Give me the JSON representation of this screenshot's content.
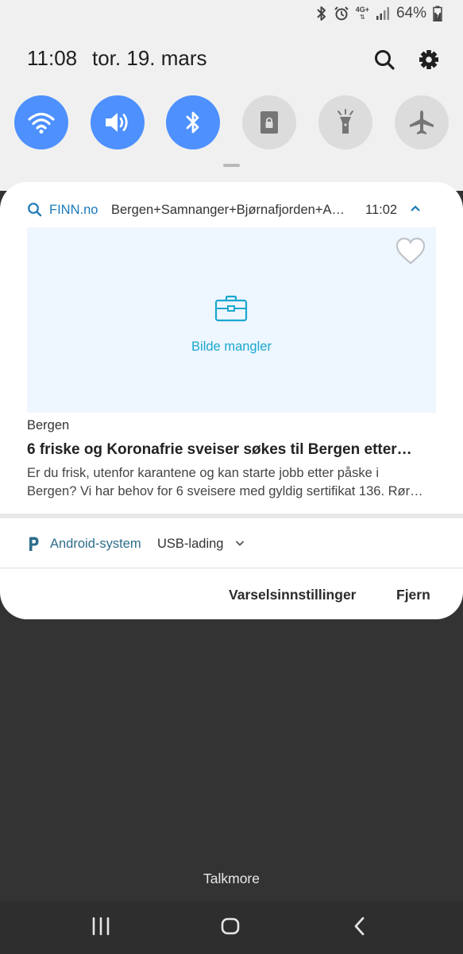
{
  "status_bar": {
    "network_label": "4G+",
    "battery": "64%",
    "icons": [
      "bluetooth-icon",
      "alarm-icon",
      "network-4g-icon",
      "signal-icon",
      "battery-charging-icon"
    ]
  },
  "header": {
    "time": "11:08",
    "date": "tor. 19. mars"
  },
  "quick_settings": [
    {
      "name": "wifi",
      "active": true
    },
    {
      "name": "sound",
      "active": true
    },
    {
      "name": "bluetooth",
      "active": true
    },
    {
      "name": "rotation-lock",
      "active": false
    },
    {
      "name": "flashlight",
      "active": false
    },
    {
      "name": "airplane-mode",
      "active": false
    }
  ],
  "notification": {
    "app": "FINN.no",
    "subtext": "Bergen+Samnanger+Bjørnafjorden+A…",
    "time": "11:02",
    "image_placeholder": "Bilde mangler",
    "location": "Bergen",
    "title": "6 friske og Koronafrie sveiser søkes til Bergen etter…",
    "body_line1": "Er du frisk, utenfor karantene og kan starte jobb etter påske i",
    "body_line2": "Bergen? Vi har behov for 6 sveisere med gyldig sertifikat 136. Rør…"
  },
  "system_notification": {
    "app": "Android-system",
    "text": "USB-lading"
  },
  "actions": {
    "settings": "Varselsinnstillinger",
    "remove": "Fjern"
  },
  "carrier": "Talkmore",
  "colors": {
    "accent": "#4d90fe",
    "finn_blue": "#1a7ab8",
    "placeholder_text": "#1aa8cd",
    "shade_bg": "#f0f0f0",
    "backdrop": "#333333"
  }
}
